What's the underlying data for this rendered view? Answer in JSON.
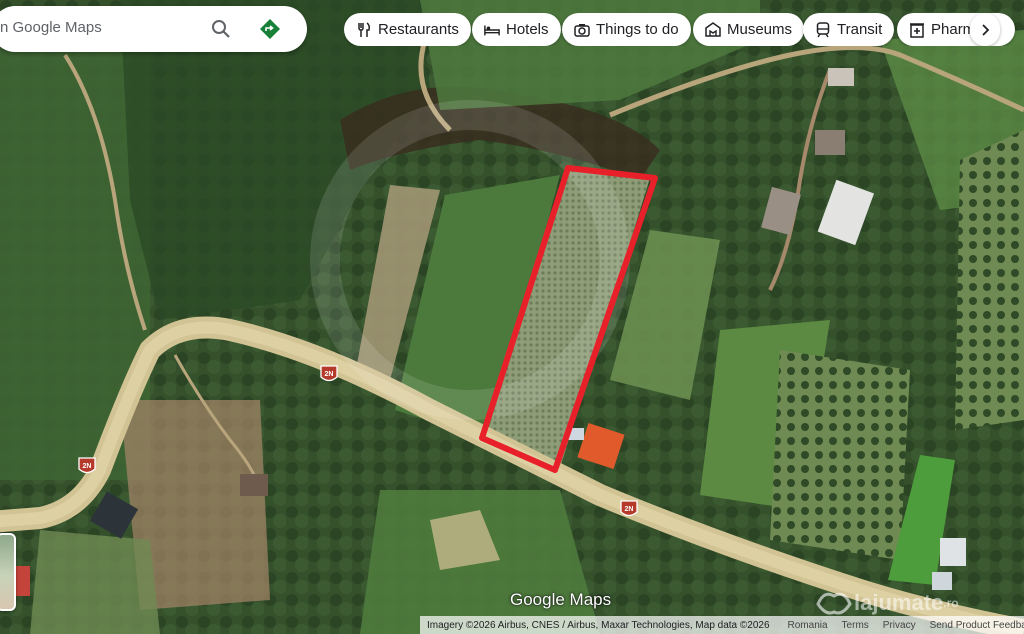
{
  "search": {
    "placeholder": "Search Google Maps",
    "visible_text": "n Google Maps"
  },
  "categories": [
    {
      "label": "Restaurants",
      "icon": "fork-knife-icon"
    },
    {
      "label": "Hotels",
      "icon": "bed-icon"
    },
    {
      "label": "Things to do",
      "icon": "camera-icon"
    },
    {
      "label": "Museums",
      "icon": "museum-icon"
    },
    {
      "label": "Transit",
      "icon": "train-icon"
    },
    {
      "label": "Pharm",
      "icon": "pharmacy-icon"
    }
  ],
  "map": {
    "view": "satellite",
    "road_shield": "2N",
    "logo": "Google Maps",
    "highlight_color": "#e8202a"
  },
  "attribution": {
    "imagery": "Imagery ©2026 Airbus, CNES / Airbus, Maxar Technologies, Map data ©2026",
    "region": "Romania",
    "terms": "Terms",
    "privacy": "Privacy",
    "feedback": "Send Product Feedback"
  },
  "watermark": {
    "text": "lajumate",
    "suffix": ".ro"
  },
  "colors": {
    "vegetation_dark": "#2c4626",
    "vegetation_mid": "#4c6b3c",
    "road": "#d2c394",
    "accent_directions": "#188038"
  }
}
